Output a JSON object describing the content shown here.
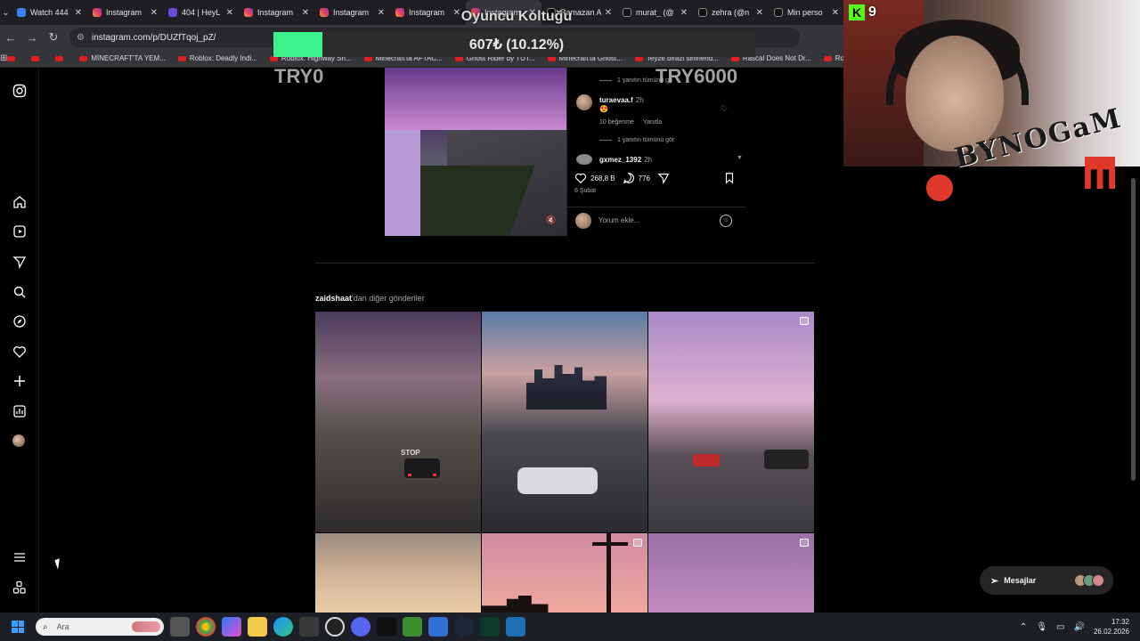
{
  "browser": {
    "tabs": [
      {
        "label": "Watch 444",
        "icon": "fav-yt",
        "active": false
      },
      {
        "label": "Instagram",
        "icon": "fav-ig",
        "active": false
      },
      {
        "label": "404 | HeyL",
        "icon": "fav-hey",
        "active": false
      },
      {
        "label": "Instagram",
        "icon": "fav-ig",
        "active": false
      },
      {
        "label": "Instagram",
        "icon": "fav-ig",
        "active": false
      },
      {
        "label": "Instagram",
        "icon": "fav-ig",
        "active": false
      },
      {
        "label": "Instagram",
        "icon": "fav-ig",
        "active": true
      },
      {
        "label": "Ramazan A",
        "icon": "fav-tt",
        "active": false
      },
      {
        "label": "murat_ (@",
        "icon": "fav-tt",
        "active": false
      },
      {
        "label": "zehra (@n",
        "icon": "fav-tt",
        "active": false
      },
      {
        "label": "Min perso",
        "icon": "fav-tt",
        "active": false
      }
    ],
    "url": "instagram.com/p/DUZfTqoj_pZ/",
    "bookmarks": [
      {
        "label": "",
        "yt": true
      },
      {
        "label": "",
        "yt": true
      },
      {
        "label": "",
        "yt": true
      },
      {
        "label": "MİNECRAFT'TA YEM...",
        "yt": true
      },
      {
        "label": "Roblox: Deadly Indi...",
        "yt": true
      },
      {
        "label": "Roblox: Highway Sh...",
        "yt": true
      },
      {
        "label": "Minecraft'ta AFTAC...",
        "yt": true
      },
      {
        "label": "Ghost Rider by TUT...",
        "yt": true
      },
      {
        "label": "Minecraft'ta Ghost...",
        "yt": true
      },
      {
        "label": "Teyze birazi sinirlend...",
        "yt": true
      },
      {
        "label": "Rascal Does Not Dr...",
        "yt": true
      },
      {
        "label": "Ro",
        "yt": true
      }
    ]
  },
  "overlay": {
    "title": "Oyuncu Koltuğu",
    "progress_percent": 10.12,
    "progress_text": "607₺ (10.12%)",
    "min_label": "TRY0",
    "max_label": "TRY6000",
    "kick_count": "9",
    "kick_letter": "K",
    "brand": "BYNOGaM",
    "fill_color": "#3cf18a"
  },
  "post": {
    "comments": [
      {
        "type": "replies",
        "text": "1 yanıtın tümünü gö"
      },
      {
        "type": "comment",
        "user": "turaevaa.f",
        "time": "2h",
        "text": "😍",
        "likes": "10 beğenme",
        "reply": "Yanıtla"
      },
      {
        "type": "replies",
        "text": "1 yanıtın tümünü gör"
      },
      {
        "type": "comment",
        "user": "gxmez_1392",
        "time": "2h"
      }
    ],
    "likes": "268,8 B",
    "comments_count": "776",
    "date": "6 Şubat",
    "comment_placeholder": "Yorum ekle..."
  },
  "more": {
    "username": "zaidshaat",
    "suffix": "'dan diğer gönderiler"
  },
  "grid": [
    {
      "name": "grid-post-street-stop",
      "reel": false
    },
    {
      "name": "grid-post-city-skyline",
      "reel": false
    },
    {
      "name": "grid-post-intersection",
      "reel": true
    },
    {
      "name": "grid-post-sunset-sky",
      "reel": false
    },
    {
      "name": "grid-post-pole-silhouette",
      "reel": true
    },
    {
      "name": "grid-post-palm-purple",
      "reel": true
    }
  ],
  "messages": {
    "label": "Mesajlar"
  },
  "taskbar": {
    "search_placeholder": "Ara",
    "time": "17:32",
    "date": "26.02.2026"
  },
  "colors": {
    "accent_green": "#3cf18a",
    "kick_green": "#53fc18",
    "brand_red": "#e0392b",
    "background": "#000000"
  }
}
